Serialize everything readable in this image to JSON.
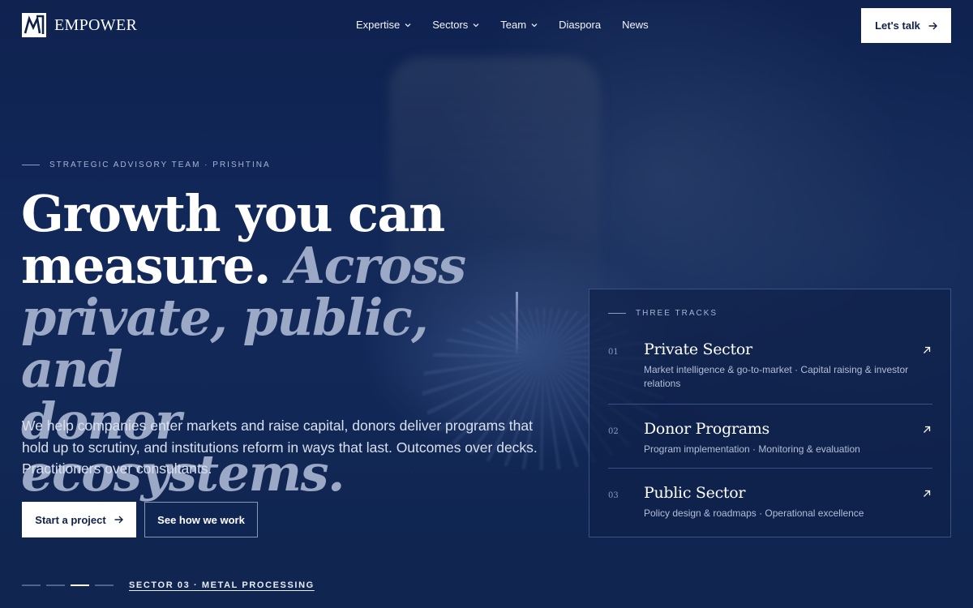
{
  "nav": {
    "brand": "EMPOWER",
    "menu": [
      {
        "label": "Expertise",
        "dropdown": true
      },
      {
        "label": "Sectors",
        "dropdown": true
      },
      {
        "label": "Team",
        "dropdown": true
      },
      {
        "label": "Diaspora",
        "dropdown": false
      },
      {
        "label": "News",
        "dropdown": false
      }
    ],
    "cta_label": "Let's talk"
  },
  "hero": {
    "eyebrow": "STRATEGIC ADVISORY TEAM · PRISHTINA",
    "headline_line1": "Growth you can",
    "headline_line2_plain": "measure.",
    "headline_line2_accent": "Across",
    "headline_line3": "private, public, and",
    "headline_line4": "donor ecosystems.",
    "lede": "We help companies enter markets and raise capital, donors deliver programs that hold up to scrutiny, and institutions reform in ways that last. Outcomes over decks. Practitioners over consultants.",
    "primary_cta": "Start a project",
    "secondary_cta": "See how we work",
    "slide_label": "SECTOR 03 · METAL PROCESSING",
    "active_slide": 2,
    "slide_count": 4
  },
  "tracks": {
    "heading": "THREE TRACKS",
    "items": [
      {
        "num": "01",
        "title": "Private Sector",
        "desc": "Market intelligence & go-to-market · Capital raising & investor relations"
      },
      {
        "num": "02",
        "title": "Donor Programs",
        "desc": "Program implementation · Monitoring & evaluation"
      },
      {
        "num": "03",
        "title": "Public Sector",
        "desc": "Policy design & roadmaps · Operational excellence"
      }
    ]
  },
  "colors": {
    "background": "#0f2149",
    "accent_text": "#9ca9c6",
    "button_bg": "#ffffff",
    "panel_border": "#3b5083"
  },
  "icons": {
    "logo": "empower-logo-icon",
    "dropdown": "chevron-down-icon",
    "cta_arrow": "arrow-right-icon",
    "track_link": "arrow-up-right-icon"
  }
}
